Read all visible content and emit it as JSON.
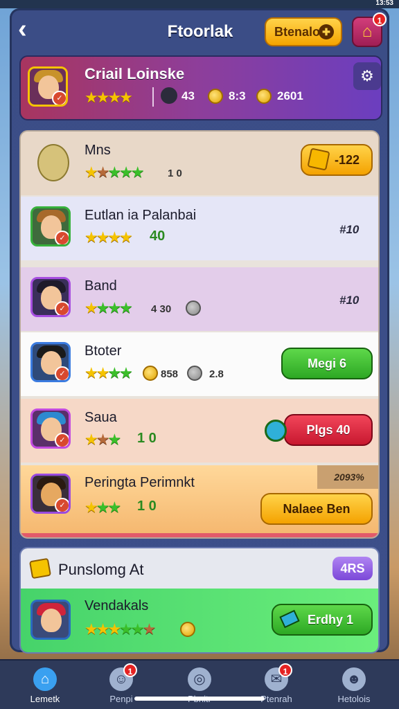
{
  "status": {
    "time": "13:53"
  },
  "header": {
    "title": "Ftoorlak",
    "action_button": "Btenalo",
    "home_badge": "1"
  },
  "profile": {
    "name": "Criail Loinske",
    "stat_a": "43",
    "stat_b": "8:3",
    "stat_c": "2601"
  },
  "list": [
    {
      "name": "Mns",
      "stars": "2 gold 1 brown 3 green",
      "extra": "1 0",
      "action": "-122",
      "action_style": "yellow"
    },
    {
      "name": "Eutlan ia Palanbai",
      "extra": "40",
      "right_value": "#10"
    },
    {
      "name": "Band",
      "extra": "4 30",
      "right_value": "#10"
    },
    {
      "name": "Btoter",
      "extra": "858",
      "extra2": "2.8",
      "action": "Megi 6",
      "action_style": "green"
    },
    {
      "name": "Saua",
      "extra": "1 0",
      "action": "Plgs 40",
      "action_style": "red"
    },
    {
      "name": "Peringta Perimnkt",
      "extra": "1 0",
      "tag": "2093%",
      "action": "Nalaee Ben",
      "action_style": "yellow"
    }
  ],
  "section2": {
    "title": "Punslomg At",
    "pill": "4RS",
    "row": {
      "name": "Vendakals",
      "action": "Erdhy 1"
    }
  },
  "nav": [
    {
      "label": "Lemetk",
      "icon": "home-icon",
      "badge": ""
    },
    {
      "label": "Penpi",
      "icon": "chat-icon",
      "badge": "1"
    },
    {
      "label": "Pbnitr",
      "icon": "search-icon",
      "badge": ""
    },
    {
      "label": "Ptenrah",
      "icon": "message-icon",
      "badge": "1"
    },
    {
      "label": "Hetolois",
      "icon": "profile-icon",
      "badge": ""
    }
  ]
}
